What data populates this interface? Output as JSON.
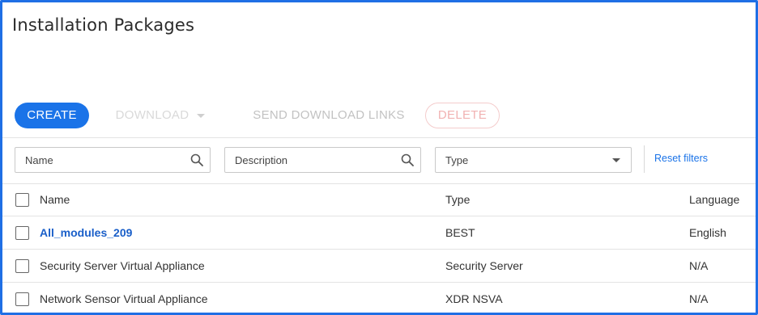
{
  "page": {
    "title": "Installation Packages"
  },
  "toolbar": {
    "create_label": "CREATE",
    "download_label": "DOWNLOAD",
    "send_links_label": "SEND DOWNLOAD LINKS",
    "delete_label": "DELETE"
  },
  "filters": {
    "name_placeholder": "Name",
    "description_placeholder": "Description",
    "type_placeholder": "Type",
    "reset_label": "Reset filters"
  },
  "table": {
    "columns": {
      "name": "Name",
      "type": "Type",
      "language": "Language"
    },
    "rows": [
      {
        "name": "All_modules_209",
        "type": "BEST",
        "language": "English",
        "is_link": true
      },
      {
        "name": "Security Server Virtual Appliance",
        "type": "Security Server",
        "language": "N/A"
      },
      {
        "name": "Network Sensor Virtual Appliance",
        "type": "XDR NSVA",
        "language": "N/A"
      }
    ]
  },
  "colors": {
    "accent": "#1a73e8",
    "frame_border": "#1f6fe5",
    "disabled_text": "#c2c2c2",
    "delete_disabled": "#f1b2b2"
  },
  "icons": {
    "search": "search-icon",
    "dropdown": "chevron-down-icon",
    "checkbox": "checkbox-icon"
  }
}
